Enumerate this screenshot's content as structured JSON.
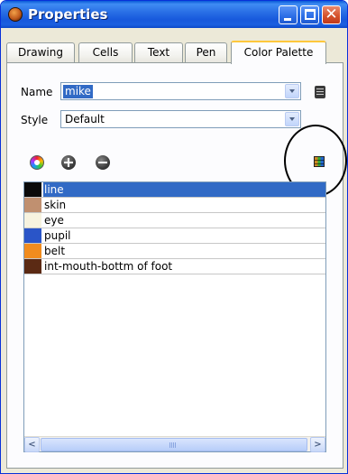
{
  "window": {
    "title": "Properties"
  },
  "tabs": [
    {
      "label": "Drawing"
    },
    {
      "label": "Cells"
    },
    {
      "label": "Text"
    },
    {
      "label": "Pen"
    },
    {
      "label": "Color Palette",
      "active": true
    }
  ],
  "form": {
    "name_label": "Name",
    "name_value": "mike",
    "style_label": "Style",
    "style_value": "Default"
  },
  "toolbar": {
    "icons": [
      "color-wheel-icon",
      "add-icon",
      "remove-icon",
      "palette-grid-icon"
    ]
  },
  "colors": [
    {
      "name": "line",
      "swatch": "#0a0a0a",
      "selected": true
    },
    {
      "name": "skin",
      "swatch": "#c09070"
    },
    {
      "name": "eye",
      "swatch": "#f7f3df"
    },
    {
      "name": "pupil",
      "swatch": "#2a55c8"
    },
    {
      "name": "belt",
      "swatch": "#f18c1e"
    },
    {
      "name": "int-mouth-bottm of foot",
      "swatch": "#5b2a14"
    }
  ],
  "accent": {
    "titlebar": "#2a70e6",
    "selection": "#316ac5",
    "close": "#d5532c"
  }
}
